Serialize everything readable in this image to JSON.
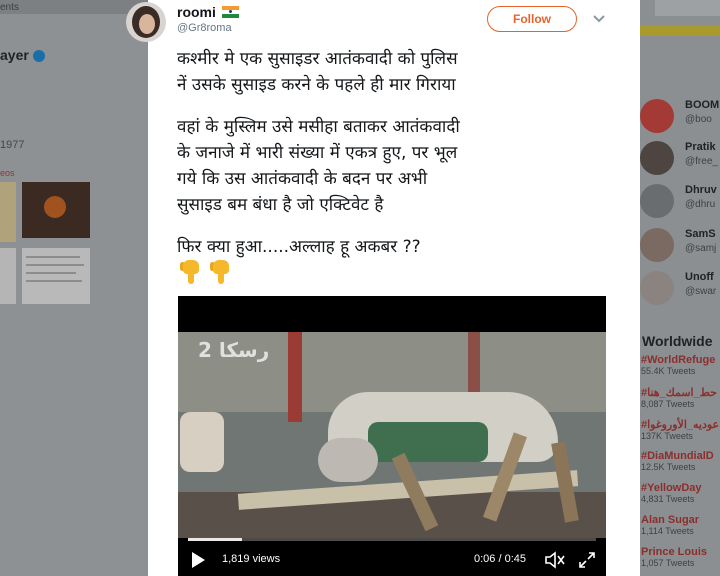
{
  "background": {
    "tabs_text": "ents",
    "profile_name": "ayer",
    "year_text": "1977",
    "videos_text": "eos",
    "who_to_follow": [
      {
        "name": "BOOM",
        "handle": "@boo"
      },
      {
        "name": "Pratik",
        "handle": "@free_"
      },
      {
        "name": "Dhruv",
        "handle": "@dhru"
      },
      {
        "name": "SamS",
        "handle": "@samj"
      },
      {
        "name": "Unoff",
        "handle": "@swar"
      }
    ],
    "trends_title": "Worldwide",
    "trends": [
      {
        "name": "#WorldRefuge",
        "count": "55.4K Tweets"
      },
      {
        "name": "#حط_اسمك_هنا",
        "count": "8,087 Tweets"
      },
      {
        "name": "#عوديه_الأوروغوا",
        "count": "137K Tweets"
      },
      {
        "name": "#DiaMundialD",
        "count": "12.5K Tweets"
      },
      {
        "name": "#YellowDay",
        "count": "4,831 Tweets"
      },
      {
        "name": "Alan Sugar",
        "count": "1,114 Tweets"
      },
      {
        "name": "Prince Louis",
        "count": "1,057 Tweets"
      }
    ]
  },
  "tweet": {
    "display_name": "roomi",
    "handle": "@Gr8roma",
    "follow_label": "Follow",
    "paragraphs": [
      [
        "कश्मीर मे एक सुसाइडर  आतंकवादी को पुलिस",
        "नें उसके सुसाइड करने के पहले ही मार गिराया"
      ],
      [
        "वहां के मुस्लिम उसे मसीहा बताकर आतंकवादी",
        "के जनाजे में भारी संख्या में एकत्र हुए, पर भूल",
        "गये कि उस आतंकवादी के बदन पर अभी",
        "सुसाइड बम बंधा है जो एक्टिवेट है"
      ],
      [
        "फिर क्या हुआ.....अल्लाह हू अकबर ??"
      ]
    ],
    "emoji_icon": "backhand-index-pointing-down",
    "video": {
      "views": "1,819 views",
      "time": "0:06 / 0:45",
      "progress": 0.133,
      "logo_text": "رسكا 2"
    }
  },
  "colors": {
    "follow_accent": "#e8632b",
    "handle_gray": "#657786"
  }
}
